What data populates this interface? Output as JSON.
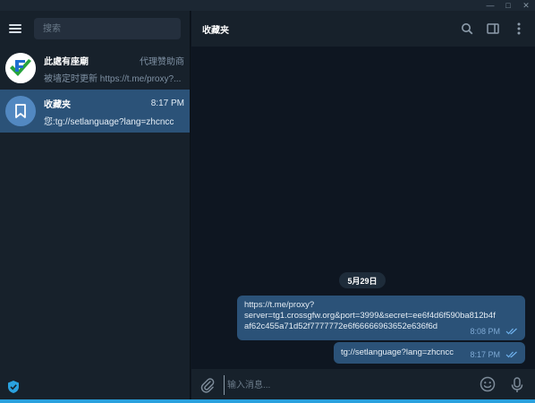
{
  "window": {
    "controls": [
      "minimize",
      "maximize",
      "close"
    ]
  },
  "sidebar": {
    "search_placeholder": "搜索",
    "chats": [
      {
        "title": "此處有座廟",
        "meta": "代理赞助商",
        "preview": "被墙定时更新 https://t.me/proxy?...",
        "active": false,
        "avatar": "logo-avatar"
      },
      {
        "title": "收藏夹",
        "meta": "8:17 PM",
        "preview": "您:tg://setlanguage?lang=zhcncc",
        "active": true,
        "avatar": "bookmark-icon"
      }
    ]
  },
  "main": {
    "title": "收藏夹",
    "date_label": "5月29日",
    "messages": [
      {
        "text": "https://t.me/proxy?\nserver=tg1.crossgfw.org&port=3999&secret=ee6f4d6f590ba812b4f\naf62c455a71d52f7777772e6f66666963652e636f6d",
        "time": "8:08 PM"
      },
      {
        "text": "tg://setlanguage?lang=zhcncc",
        "time": "8:17 PM"
      }
    ],
    "composer_placeholder": "输入消息..."
  },
  "colors": {
    "accent": "#2aa1de",
    "active_chat": "#2b5278",
    "outgoing_bubble": "#2b5278",
    "background": "#0e1621",
    "panel": "#17212b"
  }
}
